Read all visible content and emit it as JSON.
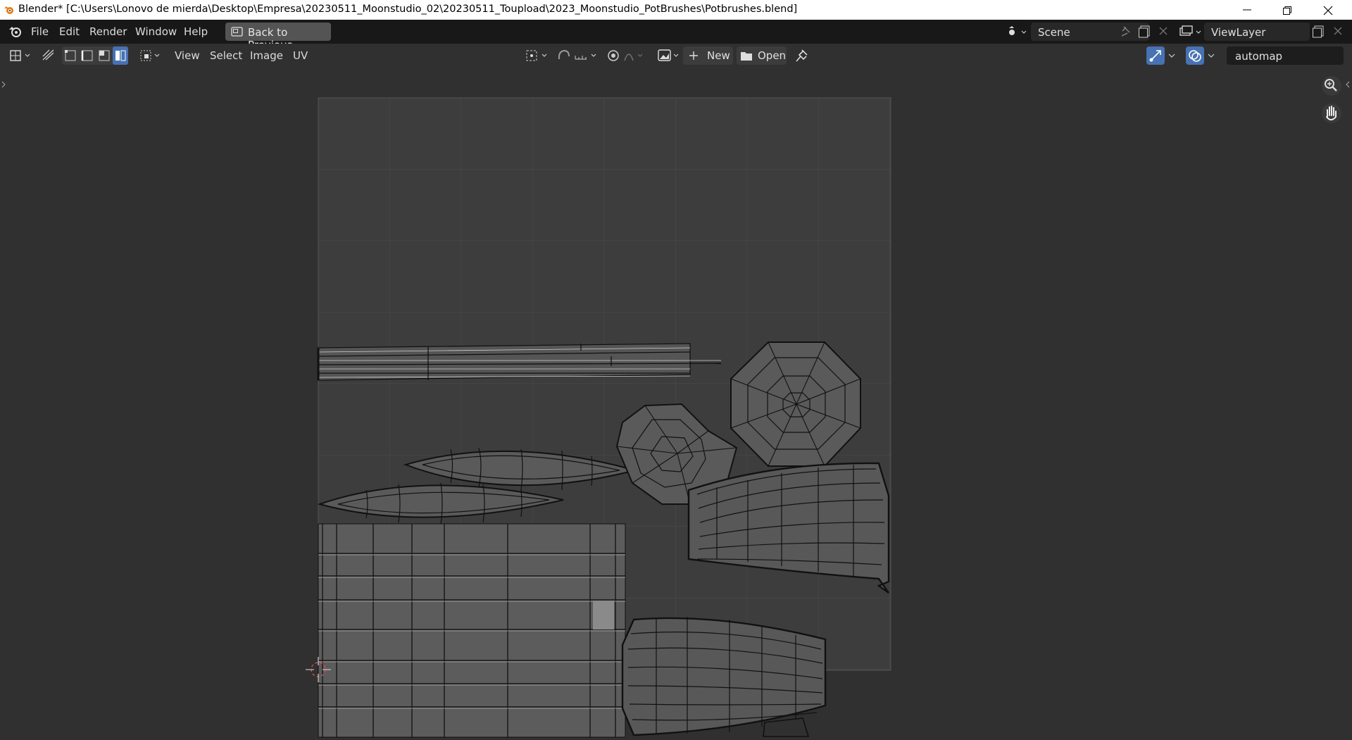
{
  "window": {
    "title": "Blender* [C:\\Users\\Lonovo de mierda\\Desktop\\Empresa\\20230511_Moonstudio_02\\20230511_Toupload\\2023_Moonstudio_PotBrushes\\Potbrushes.blend]",
    "controls": [
      "minimize-icon",
      "restore-icon",
      "close-icon"
    ]
  },
  "menubar": {
    "items": [
      "File",
      "Edit",
      "Render",
      "Window",
      "Help"
    ],
    "back_button": "Back to Previous",
    "scene": "Scene",
    "view_layer": "ViewLayer"
  },
  "header": {
    "menus": [
      "View",
      "Select",
      "Image",
      "UV"
    ],
    "new_label": "New",
    "open_label": "Open",
    "uv_map": "automap"
  },
  "colors": {
    "titlebar": "#ffffff",
    "menubar": "#181818",
    "editor_bg": "#303030",
    "uv_canvas": "#3d3d3d",
    "uv_face": "#5c5c5c",
    "selected_face": "#8a8a8a",
    "accent_blue": "#4772b3",
    "cursor_red": "#d94a4a"
  }
}
